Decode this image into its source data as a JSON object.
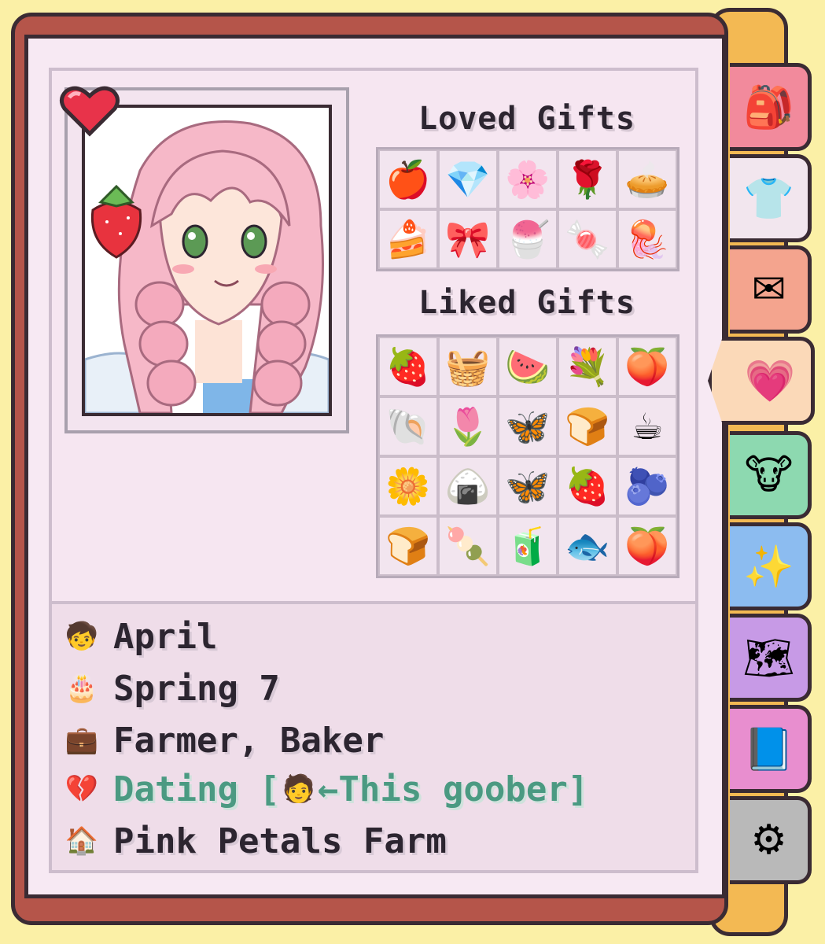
{
  "profile": {
    "portrait_alt": "April portrait",
    "status_icon": "heart-icon"
  },
  "gifts": {
    "loved_title": "Loved Gifts",
    "liked_title": "Liked Gifts",
    "loved": [
      {
        "icon": "apple-icon",
        "glyph": "🍎"
      },
      {
        "icon": "diamond-icon",
        "glyph": "💎"
      },
      {
        "icon": "pink-blob-icon",
        "glyph": "🌸"
      },
      {
        "icon": "blue-rose-icon",
        "glyph": "🌹"
      },
      {
        "icon": "pie-icon",
        "glyph": "🥧"
      },
      {
        "icon": "cake-icon",
        "glyph": "🍰"
      },
      {
        "icon": "pink-bow-icon",
        "glyph": "🎀"
      },
      {
        "icon": "sundae-icon",
        "glyph": "🍧"
      },
      {
        "icon": "candy-icon",
        "glyph": "🍬"
      },
      {
        "icon": "jellyfish-icon",
        "glyph": "🪼"
      }
    ],
    "liked": [
      {
        "icon": "strawberry-icon",
        "glyph": "🍓"
      },
      {
        "icon": "flower-basket-icon",
        "glyph": "🧺"
      },
      {
        "icon": "watermelon-icon",
        "glyph": "🍉"
      },
      {
        "icon": "flower-bouquet-icon",
        "glyph": "💐"
      },
      {
        "icon": "peach-icon",
        "glyph": "🍑"
      },
      {
        "icon": "shell-icon",
        "glyph": "🐚"
      },
      {
        "icon": "tulip-icon",
        "glyph": "🌷"
      },
      {
        "icon": "butterfly-pink-icon",
        "glyph": "🦋"
      },
      {
        "icon": "rainbow-cake-icon",
        "glyph": "🍞"
      },
      {
        "icon": "coffee-icon",
        "glyph": "☕"
      },
      {
        "icon": "flowers-icon",
        "glyph": "🌼"
      },
      {
        "icon": "onigiri-icon",
        "glyph": "🍙"
      },
      {
        "icon": "butterfly-blue-icon",
        "glyph": "🦋"
      },
      {
        "icon": "berry-icon",
        "glyph": "🍓"
      },
      {
        "icon": "blueberries-icon",
        "glyph": "🫐"
      },
      {
        "icon": "bread-icon",
        "glyph": "🍞"
      },
      {
        "icon": "skewer-icon",
        "glyph": "🍡"
      },
      {
        "icon": "juice-icon",
        "glyph": "🧃"
      },
      {
        "icon": "fish-icon",
        "glyph": "🐟"
      },
      {
        "icon": "mochi-icon",
        "glyph": "🍑"
      }
    ]
  },
  "info": {
    "name": "April",
    "birthday": "Spring 7",
    "occupation": "Farmer, Baker",
    "relationship_prefix": "Dating [",
    "relationship_suffix": "←This goober]",
    "home": "Pink Petals Farm"
  },
  "tabs": [
    {
      "name": "tab-backpack",
      "icon": "backpack-icon",
      "glyph": "🎒",
      "color": "#f28a9c"
    },
    {
      "name": "tab-clothing",
      "icon": "shirt-icon",
      "glyph": "👕",
      "color": "#f2e6ee"
    },
    {
      "name": "tab-mail",
      "icon": "envelope-icon",
      "glyph": "✉",
      "color": "#f4a48e"
    },
    {
      "name": "tab-relationships",
      "icon": "heart-icon",
      "glyph": "💗",
      "color": "#fbd9b8",
      "active": true
    },
    {
      "name": "tab-animals",
      "icon": "cow-icon",
      "glyph": "🐮",
      "color": "#8dd9b0"
    },
    {
      "name": "tab-skills",
      "icon": "sparkle-icon",
      "glyph": "✨",
      "color": "#8cbcf0"
    },
    {
      "name": "tab-map",
      "icon": "map-icon",
      "glyph": "🗺",
      "color": "#c79ae6"
    },
    {
      "name": "tab-journal",
      "icon": "book-icon",
      "glyph": "📘",
      "color": "#e88ecf"
    },
    {
      "name": "tab-settings",
      "icon": "gear-icon",
      "glyph": "⚙",
      "color": "#b9b9b9"
    }
  ],
  "colors": {
    "relationship_text": "#4b9a82",
    "accent": "#f3b953",
    "book": "#b5554a"
  }
}
